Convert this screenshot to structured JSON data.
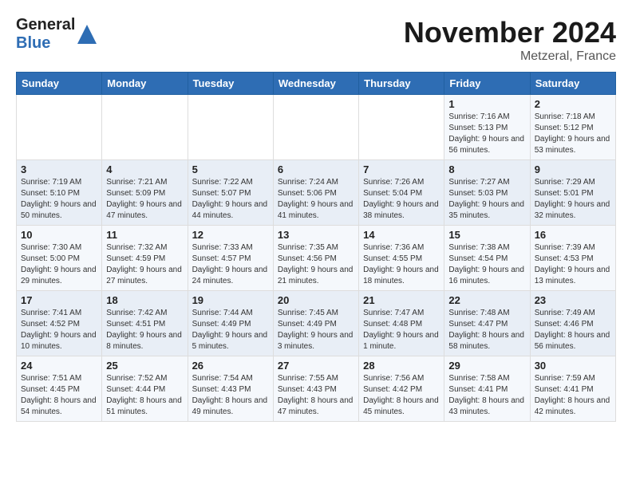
{
  "header": {
    "logo_line1": "General",
    "logo_line2": "Blue",
    "month_title": "November 2024",
    "location": "Metzeral, France"
  },
  "weekdays": [
    "Sunday",
    "Monday",
    "Tuesday",
    "Wednesday",
    "Thursday",
    "Friday",
    "Saturday"
  ],
  "weeks": [
    [
      {
        "day": "",
        "info": ""
      },
      {
        "day": "",
        "info": ""
      },
      {
        "day": "",
        "info": ""
      },
      {
        "day": "",
        "info": ""
      },
      {
        "day": "",
        "info": ""
      },
      {
        "day": "1",
        "info": "Sunrise: 7:16 AM\nSunset: 5:13 PM\nDaylight: 9 hours and 56 minutes."
      },
      {
        "day": "2",
        "info": "Sunrise: 7:18 AM\nSunset: 5:12 PM\nDaylight: 9 hours and 53 minutes."
      }
    ],
    [
      {
        "day": "3",
        "info": "Sunrise: 7:19 AM\nSunset: 5:10 PM\nDaylight: 9 hours and 50 minutes."
      },
      {
        "day": "4",
        "info": "Sunrise: 7:21 AM\nSunset: 5:09 PM\nDaylight: 9 hours and 47 minutes."
      },
      {
        "day": "5",
        "info": "Sunrise: 7:22 AM\nSunset: 5:07 PM\nDaylight: 9 hours and 44 minutes."
      },
      {
        "day": "6",
        "info": "Sunrise: 7:24 AM\nSunset: 5:06 PM\nDaylight: 9 hours and 41 minutes."
      },
      {
        "day": "7",
        "info": "Sunrise: 7:26 AM\nSunset: 5:04 PM\nDaylight: 9 hours and 38 minutes."
      },
      {
        "day": "8",
        "info": "Sunrise: 7:27 AM\nSunset: 5:03 PM\nDaylight: 9 hours and 35 minutes."
      },
      {
        "day": "9",
        "info": "Sunrise: 7:29 AM\nSunset: 5:01 PM\nDaylight: 9 hours and 32 minutes."
      }
    ],
    [
      {
        "day": "10",
        "info": "Sunrise: 7:30 AM\nSunset: 5:00 PM\nDaylight: 9 hours and 29 minutes."
      },
      {
        "day": "11",
        "info": "Sunrise: 7:32 AM\nSunset: 4:59 PM\nDaylight: 9 hours and 27 minutes."
      },
      {
        "day": "12",
        "info": "Sunrise: 7:33 AM\nSunset: 4:57 PM\nDaylight: 9 hours and 24 minutes."
      },
      {
        "day": "13",
        "info": "Sunrise: 7:35 AM\nSunset: 4:56 PM\nDaylight: 9 hours and 21 minutes."
      },
      {
        "day": "14",
        "info": "Sunrise: 7:36 AM\nSunset: 4:55 PM\nDaylight: 9 hours and 18 minutes."
      },
      {
        "day": "15",
        "info": "Sunrise: 7:38 AM\nSunset: 4:54 PM\nDaylight: 9 hours and 16 minutes."
      },
      {
        "day": "16",
        "info": "Sunrise: 7:39 AM\nSunset: 4:53 PM\nDaylight: 9 hours and 13 minutes."
      }
    ],
    [
      {
        "day": "17",
        "info": "Sunrise: 7:41 AM\nSunset: 4:52 PM\nDaylight: 9 hours and 10 minutes."
      },
      {
        "day": "18",
        "info": "Sunrise: 7:42 AM\nSunset: 4:51 PM\nDaylight: 9 hours and 8 minutes."
      },
      {
        "day": "19",
        "info": "Sunrise: 7:44 AM\nSunset: 4:49 PM\nDaylight: 9 hours and 5 minutes."
      },
      {
        "day": "20",
        "info": "Sunrise: 7:45 AM\nSunset: 4:49 PM\nDaylight: 9 hours and 3 minutes."
      },
      {
        "day": "21",
        "info": "Sunrise: 7:47 AM\nSunset: 4:48 PM\nDaylight: 9 hours and 1 minute."
      },
      {
        "day": "22",
        "info": "Sunrise: 7:48 AM\nSunset: 4:47 PM\nDaylight: 8 hours and 58 minutes."
      },
      {
        "day": "23",
        "info": "Sunrise: 7:49 AM\nSunset: 4:46 PM\nDaylight: 8 hours and 56 minutes."
      }
    ],
    [
      {
        "day": "24",
        "info": "Sunrise: 7:51 AM\nSunset: 4:45 PM\nDaylight: 8 hours and 54 minutes."
      },
      {
        "day": "25",
        "info": "Sunrise: 7:52 AM\nSunset: 4:44 PM\nDaylight: 8 hours and 51 minutes."
      },
      {
        "day": "26",
        "info": "Sunrise: 7:54 AM\nSunset: 4:43 PM\nDaylight: 8 hours and 49 minutes."
      },
      {
        "day": "27",
        "info": "Sunrise: 7:55 AM\nSunset: 4:43 PM\nDaylight: 8 hours and 47 minutes."
      },
      {
        "day": "28",
        "info": "Sunrise: 7:56 AM\nSunset: 4:42 PM\nDaylight: 8 hours and 45 minutes."
      },
      {
        "day": "29",
        "info": "Sunrise: 7:58 AM\nSunset: 4:41 PM\nDaylight: 8 hours and 43 minutes."
      },
      {
        "day": "30",
        "info": "Sunrise: 7:59 AM\nSunset: 4:41 PM\nDaylight: 8 hours and 42 minutes."
      }
    ]
  ]
}
